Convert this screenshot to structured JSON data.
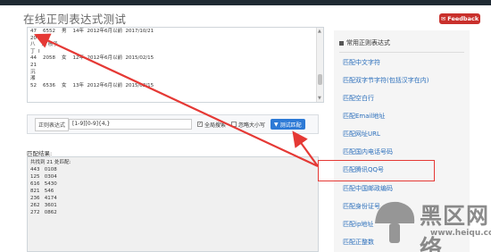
{
  "page": {
    "title": "在线正则表达式测试"
  },
  "feedback": {
    "label": "Feedback"
  },
  "input_text": {
    "lines": [
      "47    6552    男    14年  2012年6月以前  2017/10/21",
      "20",
      "八    之 核子",
      "丁  Ⅰ",
      "44    2058    女    12年  2012年6月以前  2015/02/15",
      "21",
      "沉",
      "湘",
      "52    6536    女    13年  2012年6月以前  2015/02/15"
    ]
  },
  "regex_bar": {
    "label": "正则表达式",
    "value": "[1-9][0-9]{4,}",
    "opt_global": "全局搜索",
    "opt_ignorecase": "忽略大小写",
    "test_button": "测试匹配"
  },
  "result": {
    "title": "匹配结果:",
    "lines": [
      "共找到 21 处匹配:",
      "443   0108",
      "125   0304",
      "616   5430",
      "821   546",
      "236   4174",
      "262   3601",
      "272   0862"
    ]
  },
  "sidebar": {
    "heading": "常用正则表达式",
    "items": [
      "匹配中文字符",
      "匹配双字节字符(包括汉字在内)",
      "匹配空白行",
      "匹配Email地址",
      "匹配网址URL",
      "匹配国内电话号码",
      "匹配腾讯QQ号",
      "匹配中国邮政编码",
      "匹配身份证号",
      "匹配ip地址",
      "匹配正整数"
    ]
  },
  "watermark": {
    "text": "黑区网络",
    "url": "www.heiqu.com"
  },
  "colors": {
    "link": "#2a6ebb",
    "annotation": "#e53935",
    "button": "#2d7ad6"
  }
}
